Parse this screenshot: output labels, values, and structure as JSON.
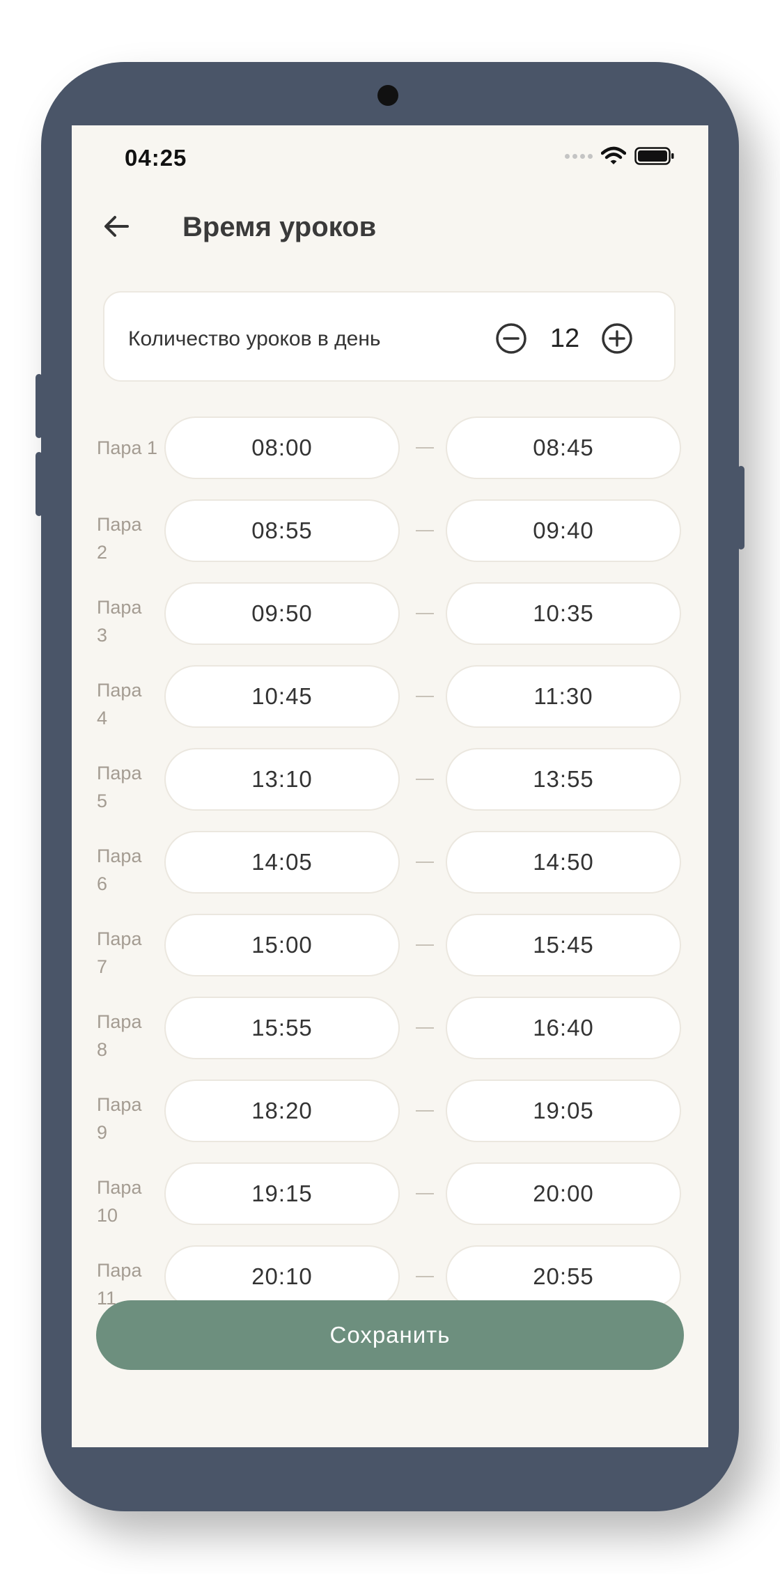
{
  "status_bar": {
    "time": "04:25"
  },
  "header": {
    "title": "Время уроков"
  },
  "lessons_count": {
    "label": "Количество уроков в день",
    "value": "12"
  },
  "lessons": [
    {
      "label": "Пара 1",
      "start": "08:00",
      "end": "08:45"
    },
    {
      "label": "Пара 2",
      "start": "08:55",
      "end": "09:40"
    },
    {
      "label": "Пара 3",
      "start": "09:50",
      "end": "10:35"
    },
    {
      "label": "Пара 4",
      "start": "10:45",
      "end": "11:30"
    },
    {
      "label": "Пара 5",
      "start": "13:10",
      "end": "13:55"
    },
    {
      "label": "Пара 6",
      "start": "14:05",
      "end": "14:50"
    },
    {
      "label": "Пара 7",
      "start": "15:00",
      "end": "15:45"
    },
    {
      "label": "Пара 8",
      "start": "15:55",
      "end": "16:40"
    },
    {
      "label": "Пара 9",
      "start": "18:20",
      "end": "19:05"
    },
    {
      "label": "Пара 10",
      "start": "19:15",
      "end": "20:00"
    },
    {
      "label": "Пара 11",
      "start": "20:10",
      "end": "20:55"
    }
  ],
  "actions": {
    "save_label": "Сохранить"
  },
  "colors": {
    "accent": "#6d8f7e",
    "background": "#f8f6f1",
    "frame": "#4a5568"
  }
}
